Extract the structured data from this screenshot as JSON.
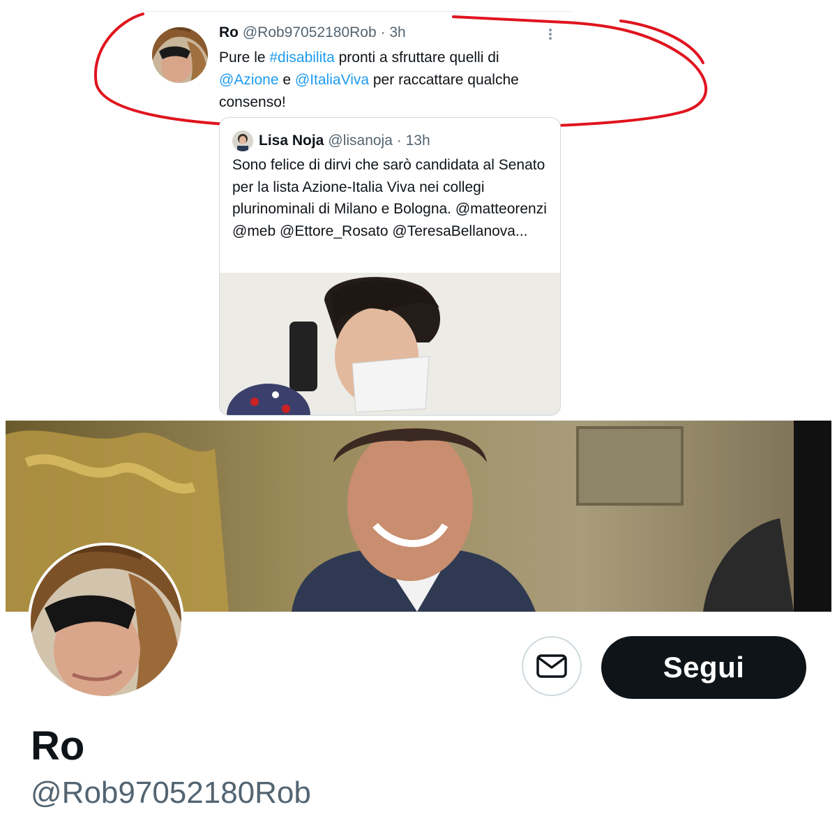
{
  "tweet": {
    "name": "Ro",
    "handle": "@Rob97052180Rob",
    "separator": "·",
    "time": "3h",
    "text": {
      "part1": "Pure le ",
      "hashtag": "#disabilita",
      "part2": " pronti a sfruttare quelli di ",
      "mention1": "@Azione",
      "part3": " e ",
      "mention2": "@ItaliaViva",
      "part4": "  per raccattare qualche consenso!"
    }
  },
  "quoted_tweet": {
    "name": "Lisa Noja",
    "handle": "@lisanoja",
    "separator": "·",
    "time": "13h",
    "text": "Sono felice di dirvi che sarò candidata al Senato per la lista Azione-Italia Viva nei collegi plurinominali di Milano e Bologna. @matteorenzi @meb @Ettore_Rosato @TeresaBellanova..."
  },
  "profile": {
    "name": "Ro",
    "handle": "@Rob97052180Rob",
    "follow_label": "Segui",
    "message_icon": "envelope-icon"
  },
  "colors": {
    "link": "#1d9bf0",
    "secondary_text": "#536471",
    "annotation": "#e0141e",
    "follow_bg": "#0f1419"
  }
}
